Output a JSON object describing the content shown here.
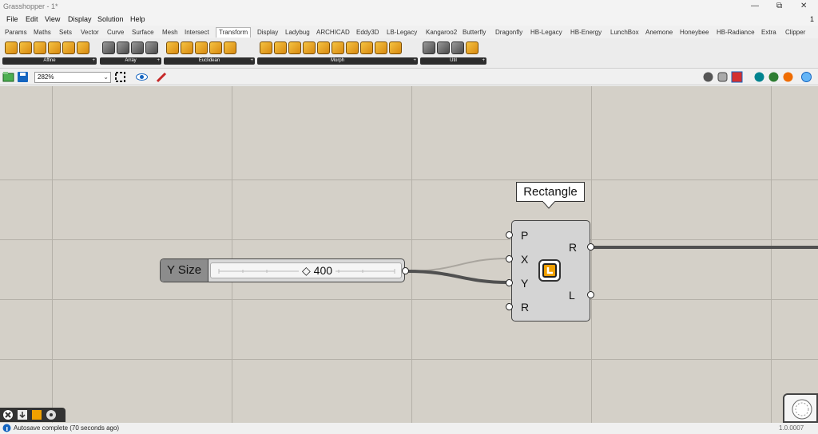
{
  "window": {
    "title": "Grasshopper - 1*",
    "minimize": "—",
    "restore": "⧉",
    "close": "✕",
    "counter": "1"
  },
  "menu": [
    "File",
    "Edit",
    "View",
    "Display",
    "Solution",
    "Help"
  ],
  "tabs": [
    "Params",
    "Maths",
    "Sets",
    "Vector",
    "Curve",
    "Surface",
    "Mesh",
    "Intersect",
    "Transform",
    "Display",
    "Ladybug",
    "ARCHICAD",
    "Eddy3D",
    "LB-Legacy",
    "Kangaroo2",
    "Butterfly",
    "Dragonfly",
    "HB-Legacy",
    "HB-Energy",
    "LunchBox",
    "Anemone",
    "Honeybee",
    "HB-Radiance",
    "Extra",
    "Clipper"
  ],
  "active_tab": "Transform",
  "ribbon_groups": [
    {
      "label": "Affine",
      "plus": "+"
    },
    {
      "label": "Array",
      "plus": "+"
    },
    {
      "label": "Euclidean",
      "plus": "+"
    },
    {
      "label": "Morph",
      "plus": "+"
    },
    {
      "label": "Util",
      "plus": "+"
    }
  ],
  "zoom": {
    "value": "282%"
  },
  "slider": {
    "name": "Y Size",
    "diamond": "◇",
    "value": "400"
  },
  "component": {
    "title": "Rectangle",
    "inputs": [
      "P",
      "X",
      "Y",
      "R"
    ],
    "outputs": [
      "R",
      "L"
    ]
  },
  "status": {
    "message": "Autosave complete (70 seconds ago)",
    "version": "1.0.0007"
  },
  "colors": {
    "canvas": "#d4d0c8",
    "grid": "#b4b0a8",
    "wire": "#505050",
    "accent": "#f0a000"
  }
}
